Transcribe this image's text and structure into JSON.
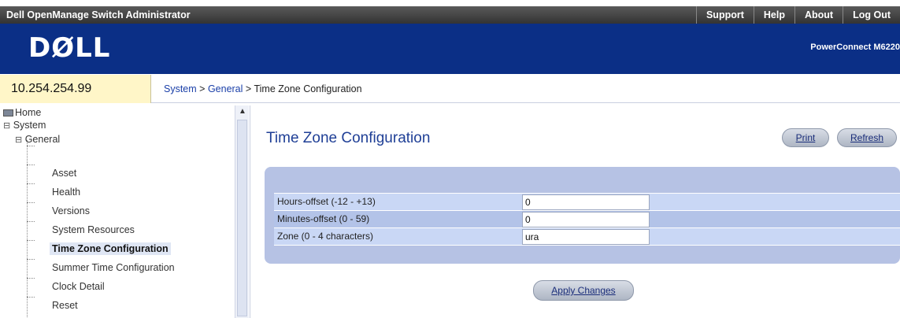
{
  "topbar": {
    "app_title": "Dell OpenManage Switch Administrator",
    "links": [
      "Support",
      "Help",
      "About",
      "Log Out"
    ]
  },
  "brand": {
    "logo": "DØLL",
    "product": "PowerConnect M6220"
  },
  "header": {
    "ip": "10.254.254.99",
    "breadcrumb": {
      "system": "System",
      "sep1": " > ",
      "general": "General",
      "sep2": " > ",
      "current": "Time Zone Configuration"
    }
  },
  "sidebar": {
    "items": [
      {
        "label": "Home"
      },
      {
        "label": "System"
      },
      {
        "label": "General"
      },
      {
        "label": "Asset"
      },
      {
        "label": "Health"
      },
      {
        "label": "Versions"
      },
      {
        "label": "System Resources"
      },
      {
        "label": "Time Zone Configuration"
      },
      {
        "label": "Summer Time Configuration"
      },
      {
        "label": "Clock Detail"
      },
      {
        "label": "Reset"
      }
    ]
  },
  "page": {
    "title": "Time Zone Configuration",
    "print_label": "Print",
    "refresh_label": "Refresh",
    "apply_label": "Apply Changes",
    "fields": [
      {
        "label": "Hours-offset (-12 - +13)",
        "value": "0"
      },
      {
        "label": "Minutes-offset (0 - 59)",
        "value": "0"
      },
      {
        "label": "Zone (0 - 4 characters)",
        "value": "ura"
      }
    ]
  },
  "colors": {
    "banner": "#0b2f86",
    "title": "#1f3f96",
    "ip_background": "#fff6c8",
    "panel": "#b6c2e4"
  }
}
